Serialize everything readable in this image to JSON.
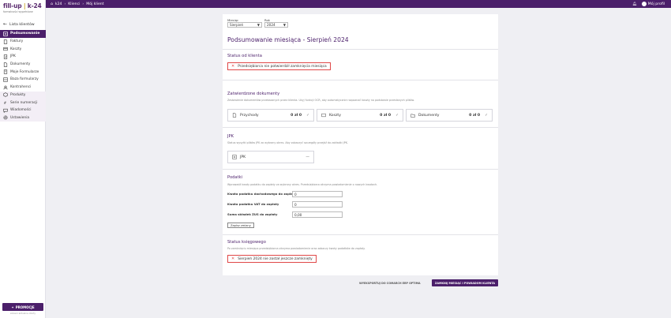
{
  "brand": {
    "logo_text": "fill-up",
    "logo_pipe": "|",
    "logo_suffix": "k-24",
    "tagline": "formalności wypełnione"
  },
  "sidebar": {
    "back_label": "Lista klientów",
    "items": [
      {
        "label": "Podsumowanie",
        "icon": "summary-icon"
      },
      {
        "label": "Faktury",
        "icon": "invoice-icon"
      },
      {
        "label": "Koszty",
        "icon": "costs-icon"
      },
      {
        "label": "JPK",
        "icon": "jpk-icon"
      },
      {
        "label": "Dokumenty",
        "icon": "documents-icon"
      },
      {
        "label": "Moje Formularze",
        "icon": "forms-icon"
      },
      {
        "label": "Baza formularzy",
        "icon": "forms-base-icon"
      },
      {
        "label": "Kontrahenci",
        "icon": "contractors-icon"
      },
      {
        "label": "Produkty",
        "icon": "products-icon"
      },
      {
        "label": "Serie numeracji",
        "icon": "numbering-icon"
      },
      {
        "label": "Wiadomości",
        "icon": "messages-icon"
      },
      {
        "label": "Ustawienia",
        "icon": "settings-icon"
      }
    ],
    "promo_label": "PROMOCJE",
    "promo_sub": "zobacz aktualne oferty"
  },
  "topbar": {
    "crumbs": [
      "k24",
      "Klienci",
      "Mój klient"
    ],
    "user_label": "Mój profil"
  },
  "filters": {
    "month_label": "Miesiąc",
    "month_value": "Sierpień",
    "year_label": "Rok",
    "year_value": "2024"
  },
  "page_title": "Podsumowanie miesiąca - Sierpień 2024",
  "client_status": {
    "title": "Status od klienta",
    "message": "Przedsiębiorca nie potwierdził zamknięcia miesiąca"
  },
  "approved_docs": {
    "title": "Zatwierdzone dokumenty",
    "desc": "Zestawienie dokumentów przekazanych przez klienta. Użyj funkcji OCR, aby automatycznie rozpoznać koszty na podstawie przesłanych plików.",
    "cards": [
      {
        "label": "Przychody",
        "value": "0 zł 0",
        "icon": "income-icon"
      },
      {
        "label": "Koszty",
        "value": "0 zł 0",
        "icon": "cost-icon"
      },
      {
        "label": "Dokumenty",
        "value": "0 zł 0",
        "icon": "folder-icon"
      }
    ]
  },
  "jpk": {
    "title": "JPK",
    "desc": "Status wysyłki plików JPK za wybrany okres. Aby zobaczyć szczegóły przejdź do zakładki JPK.",
    "card_label": "JPK",
    "card_value": "—"
  },
  "taxes": {
    "title": "Podatki",
    "desc": "Wprowadź kwoty podatku do zapłaty za wybrany okres. Przedsiębiorca otrzyma powiadomienie o nowych kwotach.",
    "rows": [
      {
        "label": "Kwota podatku dochodowego do zapłaty",
        "value": "0"
      },
      {
        "label": "Kwota podatku VAT do zapłaty",
        "value": "0"
      },
      {
        "label": "Suma składek ZUS do zapłaty",
        "value": "0,00"
      }
    ],
    "save_label": "Zapisz zmiany"
  },
  "accounting_status": {
    "title": "Status księgowego",
    "desc": "Po zamknięciu miesiąca przedsiębiorca otrzyma powiadomienie oraz zobaczy kwoty podatków do zapłaty.",
    "message": "Sierpień 2024 nie został jeszcze zamknięty"
  },
  "actions": {
    "secondary_label": "WYEKSPORTUJ DO COMARCH ERP OPTIMA",
    "primary_label": "ZAMKNIJ MIESIĄC I POWIADOM KLIENTA"
  },
  "colors": {
    "brand_purple": "#4b1f6a",
    "error_red": "#e04848",
    "accent_gold": "#c9a227"
  }
}
